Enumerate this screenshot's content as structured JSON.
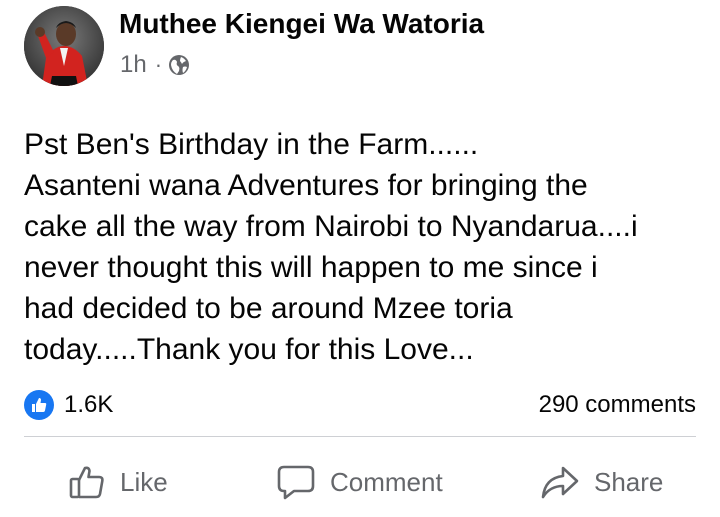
{
  "post": {
    "author_name": "Muthee Kiengei Wa Watoria",
    "timestamp": "1h",
    "separator": "·",
    "audience_icon": "globe-icon",
    "body_lines": [
      "Pst Ben's Birthday in the Farm......",
      "Asanteni wana Adventures for bringing the",
      "cake all the way from Nairobi to Nyandarua....i",
      "never thought this will happen to me since i",
      "had decided to be around Mzee toria",
      "today.....Thank you for this Love..."
    ]
  },
  "stats": {
    "reaction_icon": "like-reaction-icon",
    "reaction_count": "1.6K",
    "comments_count": "290 comments"
  },
  "actions": {
    "like_label": "Like",
    "comment_label": "Comment",
    "share_label": "Share"
  },
  "colors": {
    "accent": "#1877f2",
    "secondary_text": "#65676b",
    "primary_text": "#050505",
    "divider": "#ced0d4"
  }
}
